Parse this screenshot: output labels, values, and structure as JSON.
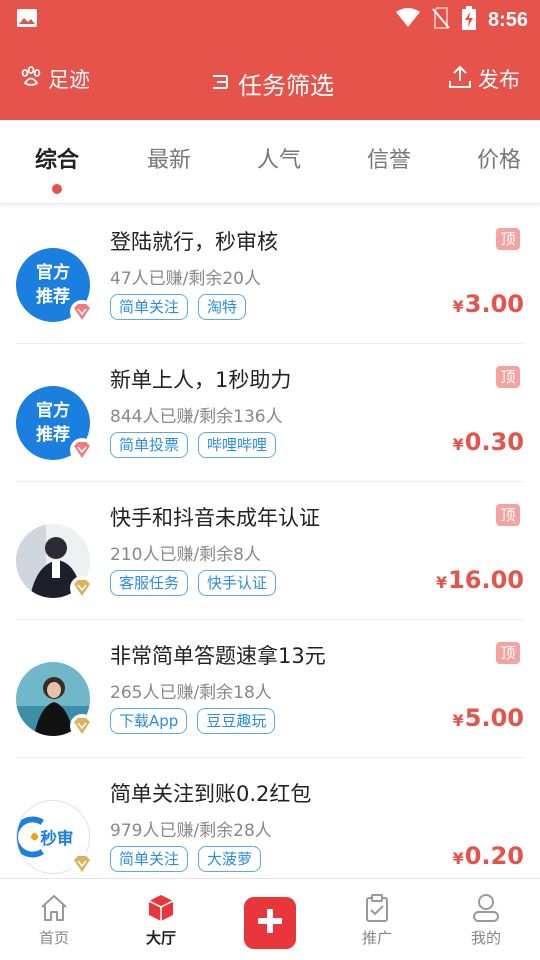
{
  "status_bar": {
    "time": "8:56",
    "icons": [
      "image-icon",
      "wifi-icon",
      "no-sim-icon",
      "battery-charging-icon"
    ]
  },
  "header": {
    "left_label": "足迹",
    "title": "任务筛选",
    "right_label": "发布",
    "background_color": "#e5534b"
  },
  "tabs": [
    {
      "label": "综合",
      "active": true
    },
    {
      "label": "最新",
      "active": false
    },
    {
      "label": "人气",
      "active": false
    },
    {
      "label": "信誉",
      "active": false
    },
    {
      "label": "价格",
      "active": false
    }
  ],
  "tasks": [
    {
      "title": "登陆就行，秒审核",
      "stats": "47人已赚/剩余20人",
      "tags": [
        "简单关注",
        "淘特"
      ],
      "top_label": "顶",
      "currency": "¥",
      "price": "3.00",
      "avatar": {
        "type": "official",
        "line1": "官方",
        "line2": "推荐",
        "badge": "red-diamond-icon"
      }
    },
    {
      "title": "新单上人，1秒助力",
      "stats": "844人已赚/剩余136人",
      "tags": [
        "简单投票",
        "哔哩哔哩"
      ],
      "top_label": "顶",
      "currency": "¥",
      "price": "0.30",
      "avatar": {
        "type": "official",
        "line1": "官方",
        "line2": "推荐",
        "badge": "red-diamond-icon"
      }
    },
    {
      "title": "快手和抖音未成年认证",
      "stats": "210人已赚/剩余8人",
      "tags": [
        "客服任务",
        "快手认证"
      ],
      "top_label": "顶",
      "currency": "¥",
      "price": "16.00",
      "avatar": {
        "type": "photo",
        "badge": "gold-diamond-icon"
      }
    },
    {
      "title": "非常简单答题速拿13元",
      "stats": "265人已赚/剩余18人",
      "tags": [
        "下载App",
        "豆豆趣玩"
      ],
      "top_label": "顶",
      "currency": "¥",
      "price": "5.00",
      "avatar": {
        "type": "photo",
        "badge": "gold-diamond-icon"
      }
    },
    {
      "title": "简单关注到账0.2红包",
      "stats": "979人已赚/剩余28人",
      "tags": [
        "简单关注",
        "大菠萝"
      ],
      "top_label": "",
      "currency": "¥",
      "price": "0.20",
      "avatar": {
        "type": "logo",
        "logo_text": "秒审",
        "badge": "gold-diamond-icon"
      }
    }
  ],
  "bottom_nav": [
    {
      "label": "首页",
      "icon": "home-icon",
      "active": false
    },
    {
      "label": "大厅",
      "icon": "hall-cube-icon",
      "active": true
    },
    {
      "label": "",
      "icon": "plus-icon",
      "active": false
    },
    {
      "label": "推广",
      "icon": "clipboard-check-icon",
      "active": false
    },
    {
      "label": "我的",
      "icon": "profile-icon",
      "active": false
    }
  ],
  "colors": {
    "accent": "#e5534b",
    "price": "#e5534b",
    "tag": "#2a8ee0",
    "official_avatar": "#1b7fe0"
  }
}
